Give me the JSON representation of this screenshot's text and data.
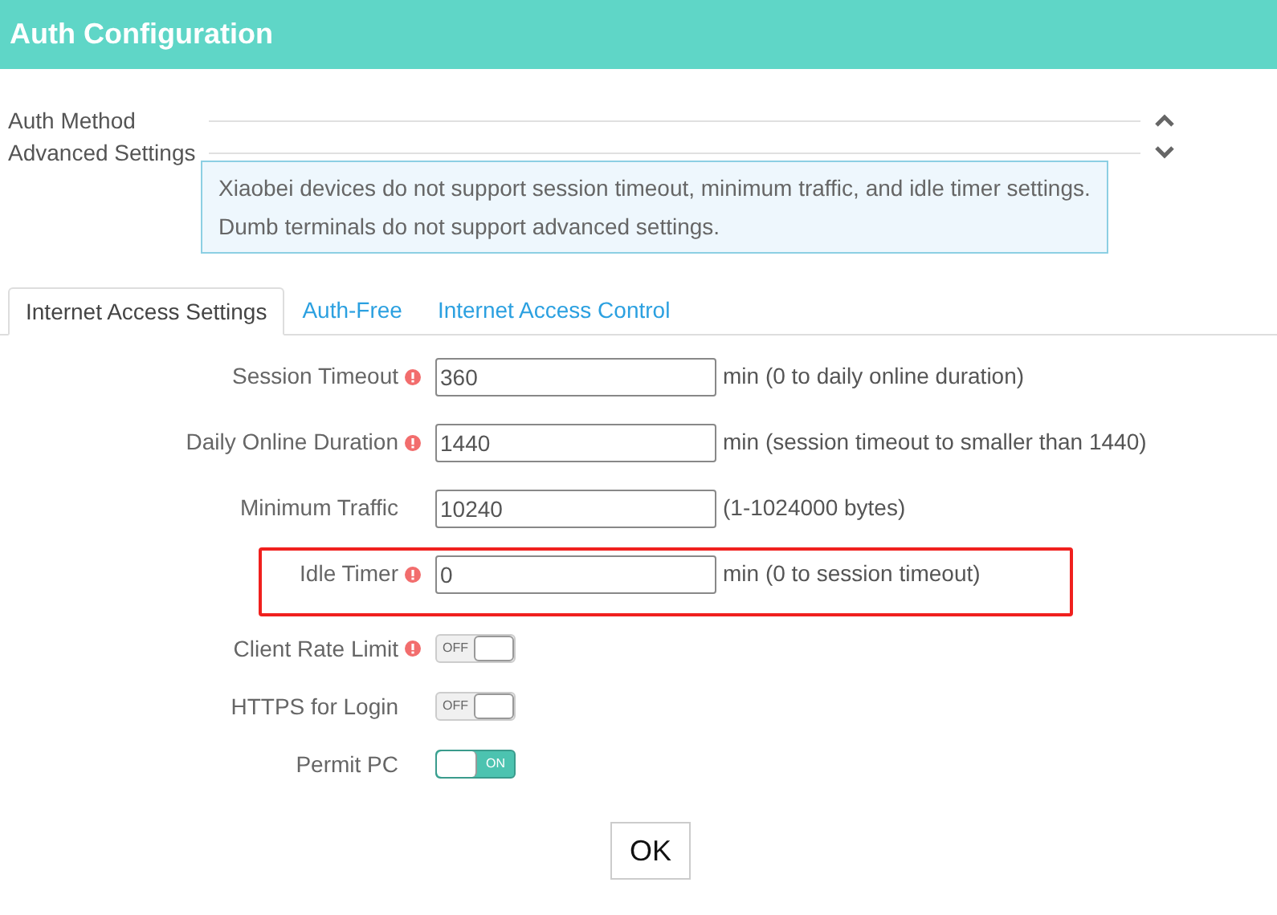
{
  "header": {
    "title": "Auth Configuration"
  },
  "sections": [
    {
      "label": "Auth Method",
      "expanded": true
    },
    {
      "label": "Advanced Settings",
      "expanded": false
    }
  ],
  "notice": [
    "Xiaobei devices do not support session timeout, minimum traffic, and idle timer settings.",
    "Dumb terminals do not support advanced settings."
  ],
  "tabs": [
    {
      "label": "Internet Access Settings",
      "selected": true
    },
    {
      "label": "Auth-Free",
      "selected": false
    },
    {
      "label": "Internet Access Control",
      "selected": false
    }
  ],
  "fields": [
    {
      "kind": "input",
      "label": "Session Timeout",
      "info": true,
      "value": "360",
      "hint": "min (0 to daily online duration)",
      "highlighted": false
    },
    {
      "kind": "input",
      "label": "Daily Online Duration",
      "info": true,
      "value": "1440",
      "hint": "min (session timeout to smaller than 1440)",
      "highlighted": false
    },
    {
      "kind": "input",
      "label": "Minimum Traffic",
      "info": false,
      "value": "10240",
      "hint": "(1-1024000 bytes)",
      "highlighted": false
    },
    {
      "kind": "input",
      "label": "Idle Timer",
      "info": true,
      "value": "0",
      "hint": "min (0 to session timeout)",
      "highlighted": true
    },
    {
      "kind": "toggle",
      "label": "Client Rate Limit",
      "info": true,
      "on": false,
      "text": "OFF"
    },
    {
      "kind": "toggle",
      "label": "HTTPS for Login",
      "info": false,
      "on": false,
      "text": "OFF"
    },
    {
      "kind": "toggle",
      "label": "Permit PC",
      "info": false,
      "on": true,
      "text": "ON"
    }
  ],
  "ok_button": "OK"
}
